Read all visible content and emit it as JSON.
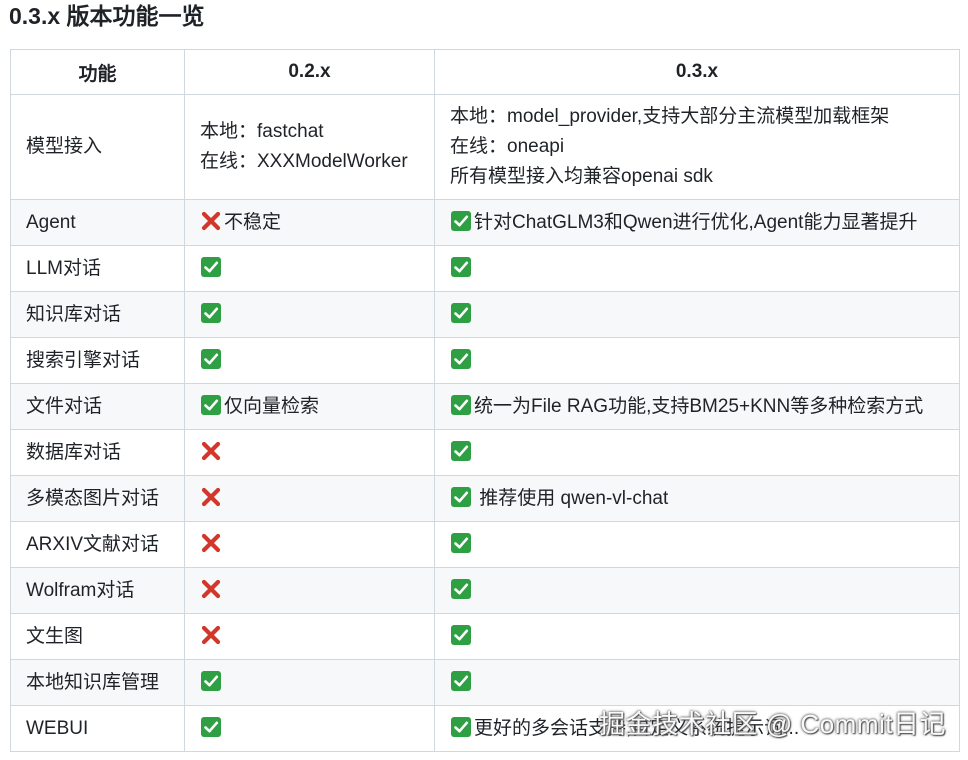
{
  "title": "0.3.x 版本功能一览",
  "headers": [
    "功能",
    "0.2.x",
    "0.3.x"
  ],
  "rows": [
    {
      "feature": "模型接入",
      "v02": {
        "icon": "",
        "lines": [
          "本地：fastchat",
          "在线：XXXModelWorker"
        ]
      },
      "v03": {
        "icon": "",
        "lines": [
          "本地：model_provider,支持大部分主流模型加载框架",
          "在线：oneapi",
          "所有模型接入均兼容openai sdk"
        ]
      }
    },
    {
      "feature": "Agent",
      "v02": {
        "icon": "cross-icon",
        "lines": [
          "不稳定"
        ]
      },
      "v03": {
        "icon": "check-icon",
        "lines": [
          "针对ChatGLM3和Qwen进行优化,Agent能力显著提升"
        ]
      }
    },
    {
      "feature": "LLM对话",
      "v02": {
        "icon": "check-icon",
        "lines": []
      },
      "v03": {
        "icon": "check-icon",
        "lines": []
      }
    },
    {
      "feature": "知识库对话",
      "v02": {
        "icon": "check-icon",
        "lines": []
      },
      "v03": {
        "icon": "check-icon",
        "lines": []
      }
    },
    {
      "feature": "搜索引擎对话",
      "v02": {
        "icon": "check-icon",
        "lines": []
      },
      "v03": {
        "icon": "check-icon",
        "lines": []
      }
    },
    {
      "feature": "文件对话",
      "v02": {
        "icon": "check-icon",
        "lines": [
          "仅向量检索"
        ]
      },
      "v03": {
        "icon": "check-icon",
        "lines": [
          "统一为File RAG功能,支持BM25+KNN等多种检索方式"
        ]
      }
    },
    {
      "feature": "数据库对话",
      "v02": {
        "icon": "cross-icon",
        "lines": []
      },
      "v03": {
        "icon": "check-icon",
        "lines": []
      }
    },
    {
      "feature": "多模态图片对话",
      "v02": {
        "icon": "cross-icon",
        "lines": []
      },
      "v03": {
        "icon": "check-icon",
        "lines": [
          " 推荐使用 qwen-vl-chat"
        ]
      }
    },
    {
      "feature": "ARXIV文献对话",
      "v02": {
        "icon": "cross-icon",
        "lines": []
      },
      "v03": {
        "icon": "check-icon",
        "lines": []
      }
    },
    {
      "feature": "Wolfram对话",
      "v02": {
        "icon": "cross-icon",
        "lines": []
      },
      "v03": {
        "icon": "check-icon",
        "lines": []
      }
    },
    {
      "feature": "文生图",
      "v02": {
        "icon": "cross-icon",
        "lines": []
      },
      "v03": {
        "icon": "check-icon",
        "lines": []
      }
    },
    {
      "feature": "本地知识库管理",
      "v02": {
        "icon": "check-icon",
        "lines": []
      },
      "v03": {
        "icon": "check-icon",
        "lines": []
      }
    },
    {
      "feature": "WEBUI",
      "v02": {
        "icon": "check-icon",
        "lines": []
      },
      "v03": {
        "icon": "check-icon",
        "lines": [
          "更好的多会话支持,自定义系统提示词..."
        ]
      }
    }
  ],
  "colors": {
    "check_bg": "#2ea043",
    "cross": "#d1372b",
    "border": "#d0d7de",
    "stripe": "#f6f8fa"
  },
  "watermark": "掘金技术社区 @ Commit日记"
}
